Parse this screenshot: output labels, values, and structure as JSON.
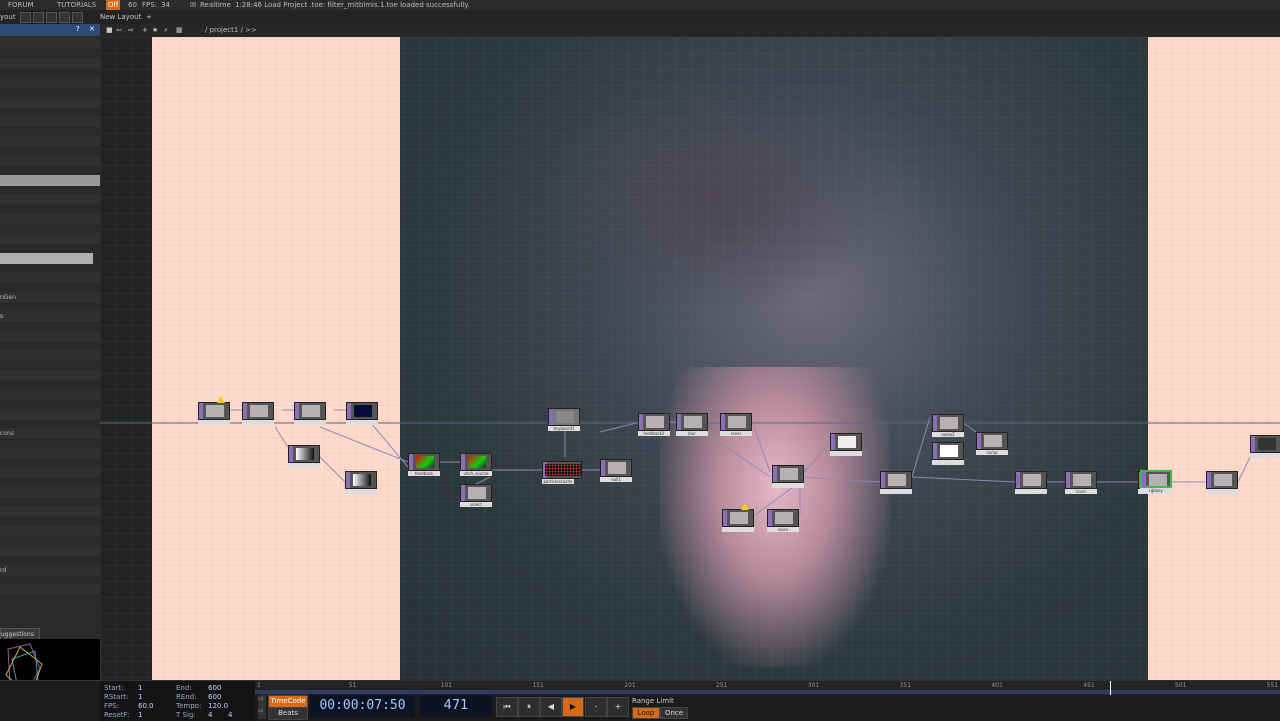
{
  "menubar": {
    "forum": "FORUM",
    "tutorials": "TUTORIALS",
    "off": "Off",
    "sixty": "60",
    "fps_label": "FPS:",
    "fps_value": "34",
    "realtime": "Realtime",
    "status": "1:28:46 Load Project .toe: filter_mitblmis.1.toe loaded successfully."
  },
  "layoutbar": {
    "layout": "yout",
    "new_layout": "New Layout",
    "plus": "+"
  },
  "leftpanel": {
    "help": "?",
    "close": "✕",
    "items": [
      "",
      "",
      "",
      "",
      "",
      "",
      "",
      "",
      "",
      "",
      "",
      "",
      "",
      "nGen",
      "s",
      "",
      "",
      "",
      "",
      "",
      "cons",
      "",
      "",
      "",
      "",
      "",
      "",
      "rd",
      ""
    ],
    "suggestions": "uggestions"
  },
  "nettoolbar": {
    "path": "/ project1 / >>"
  },
  "nodes": [
    {
      "label": "",
      "warn": true
    },
    {
      "label": ""
    },
    {
      "label": ""
    },
    {
      "label": ""
    },
    {
      "label": ""
    },
    {
      "label": ""
    },
    {
      "label": "feedback"
    },
    {
      "label": "ultrA_source"
    },
    {
      "label": "select"
    },
    {
      "label": "particlescache"
    },
    {
      "label": "null1"
    },
    {
      "label": "keyboard1"
    },
    {
      "label": "feedback2"
    },
    {
      "label": "blur"
    },
    {
      "label": "level"
    },
    {
      "label": ""
    },
    {
      "label": ""
    },
    {
      "label": "",
      "warn": true
    },
    {
      "label": "noise"
    },
    {
      "label": "noise2"
    },
    {
      "label": "comp"
    },
    {
      "label": ""
    },
    {
      "label": ""
    },
    {
      "label": ""
    },
    {
      "label": "level"
    },
    {
      "label": "constant"
    },
    {
      "label": "rgbkey"
    },
    {
      "label": ""
    },
    {
      "label": ""
    }
  ],
  "bottom": {
    "start_label": "Start:",
    "start_value": "1",
    "rstart_label": "RStart:",
    "rstart_value": "1",
    "fps_label": "FPS:",
    "fps_value": "60.0",
    "resetf_label": "ResetF:",
    "resetf_value": "1",
    "end_label": "End:",
    "end_value": "600",
    "rend_label": "REnd:",
    "rend_value": "600",
    "tempo_label": "Tempo:",
    "tempo_value": "120.0",
    "tsig_label": "T Sig:",
    "tsig_a": "4",
    "tsig_b": "4",
    "timecode_btn": "TimeCode",
    "beats_btn": "Beats",
    "timecode": "00:00:07:50",
    "frame": "471",
    "range_limit": "Range Limit",
    "loop": "Loop",
    "once": "Once",
    "ruler_ticks": [
      "1",
      "51",
      "101",
      "151",
      "201",
      "251",
      "301",
      "351",
      "401",
      "451",
      "501",
      "551"
    ]
  },
  "transport": {
    "rewind": "⏮",
    "pause": "⏸",
    "step_back": "◀",
    "play": "▶",
    "minus": "-",
    "plus": "+"
  },
  "colors": {
    "accent": "#d46a1a",
    "timecode": "#a8c6ff",
    "selected_node": "#35c23b",
    "canvas_peach": "#fed9c9"
  }
}
